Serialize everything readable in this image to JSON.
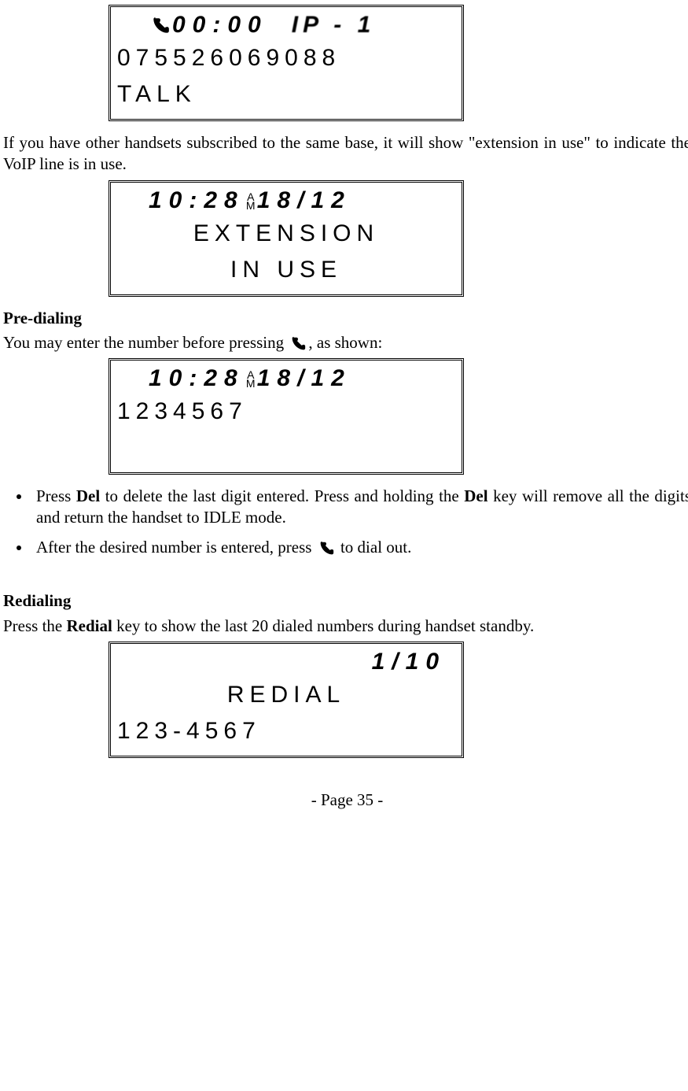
{
  "screen1": {
    "timer": "00:00",
    "ip_label": "IP - 1",
    "number": "075526069088",
    "status": "TALK"
  },
  "para1_a": "If you have other handsets subscribed to the same base, it will show \"extension in use\" to indicate the VoIP line is in use.",
  "screen2": {
    "time": "10:28",
    "ampm_top": "A",
    "ampm_bot": "M",
    "date": "18/12",
    "line2": "EXTENSION",
    "line3": "IN USE"
  },
  "predial_heading": "Pre-dialing",
  "predial_text_a": "You may enter the number before pressing ",
  "predial_text_b": ", as shown:",
  "screen3": {
    "time": "10:28",
    "ampm_top": "A",
    "ampm_bot": "M",
    "date": "18/12",
    "number": "1234567"
  },
  "bullets": {
    "b1_a": "Press ",
    "b1_bold1": "Del",
    "b1_b": " to delete the last digit entered. Press and holding the ",
    "b1_bold2": "Del",
    "b1_c": " key will remove all the digits and return the handset to IDLE mode.",
    "b2_a": "After the desired number is entered, press ",
    "b2_b": " to dial out."
  },
  "redial_heading": "Redialing",
  "redial_text_a": "Press the ",
  "redial_bold": "Redial",
  "redial_text_b": " key to show the last 20 dialed numbers during handset standby.",
  "screen4": {
    "counter": "1/10",
    "label": "REDIAL",
    "number": "123-4567"
  },
  "footer": "- Page 35 -"
}
